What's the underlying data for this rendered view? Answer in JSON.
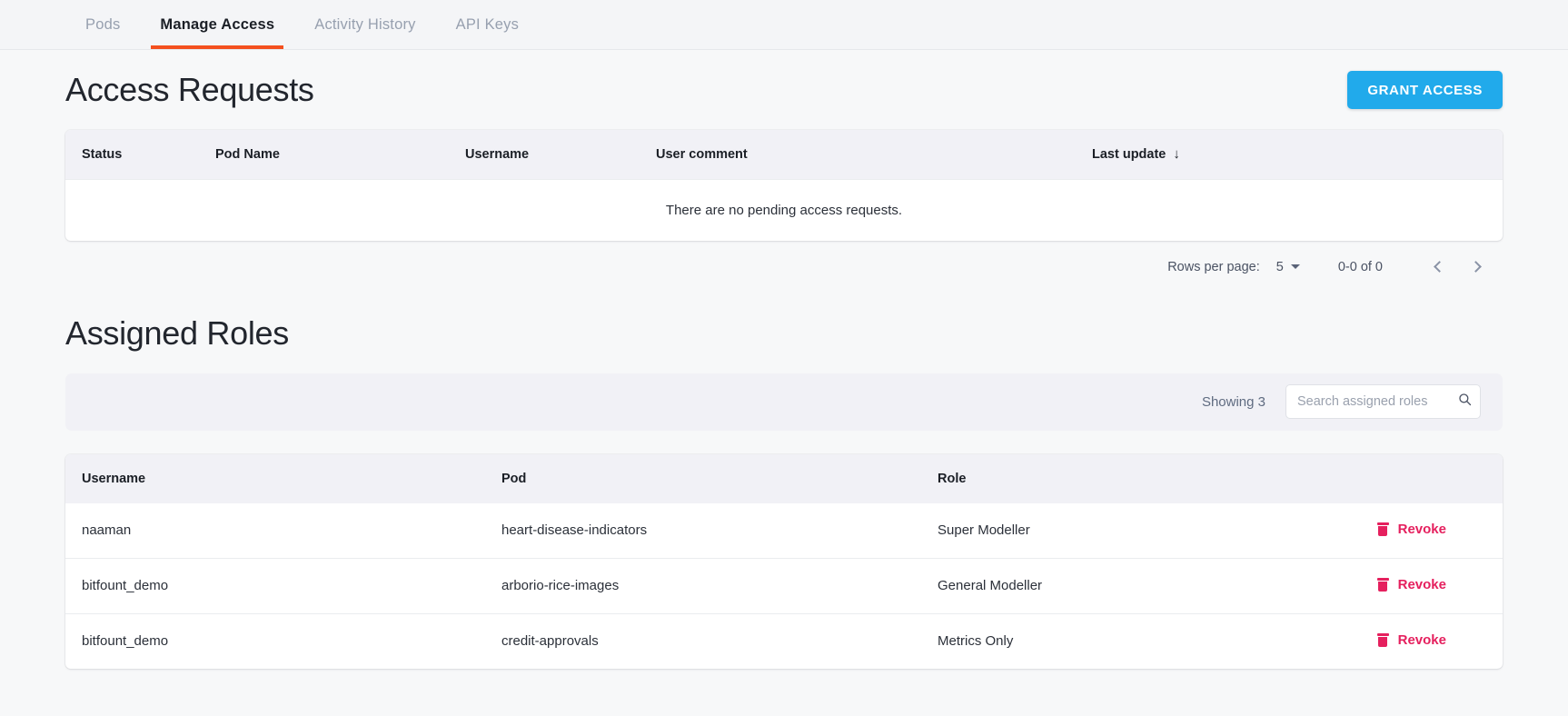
{
  "tabs": [
    {
      "label": "Pods",
      "active": false
    },
    {
      "label": "Manage Access",
      "active": true
    },
    {
      "label": "Activity History",
      "active": false
    },
    {
      "label": "API Keys",
      "active": false
    }
  ],
  "access_requests": {
    "title": "Access Requests",
    "grant_button": "GRANT ACCESS",
    "columns": [
      "Status",
      "Pod Name",
      "Username",
      "User comment",
      "Last update"
    ],
    "sort_column": "Last update",
    "sort_arrow": "↓",
    "empty_message": "There are no pending access requests.",
    "rows": [],
    "pagination": {
      "rows_per_page_label": "Rows per page:",
      "rows_per_page_value": "5",
      "range": "0-0 of 0",
      "prev_icon": "chevron-left",
      "next_icon": "chevron-right"
    }
  },
  "assigned_roles": {
    "title": "Assigned Roles",
    "showing": "Showing 3",
    "search_placeholder": "Search assigned roles",
    "search_value": "",
    "columns": [
      "Username",
      "Pod",
      "Role"
    ],
    "action_label": "Revoke",
    "rows": [
      {
        "username": "naaman",
        "pod": "heart-disease-indicators",
        "role": "Super Modeller",
        "action": "Revoke"
      },
      {
        "username": "bitfount_demo",
        "pod": "arborio-rice-images",
        "role": "General Modeller",
        "action": "Revoke"
      },
      {
        "username": "bitfount_demo",
        "pod": "credit-approvals",
        "role": "Metrics Only",
        "action": "Revoke"
      }
    ]
  },
  "colors": {
    "accent_orange": "#F4501E",
    "primary_blue": "#21AAEB",
    "danger_pink": "#E5205E",
    "header_bg": "#F1F1F6",
    "page_bg": "#F7F8F9"
  }
}
